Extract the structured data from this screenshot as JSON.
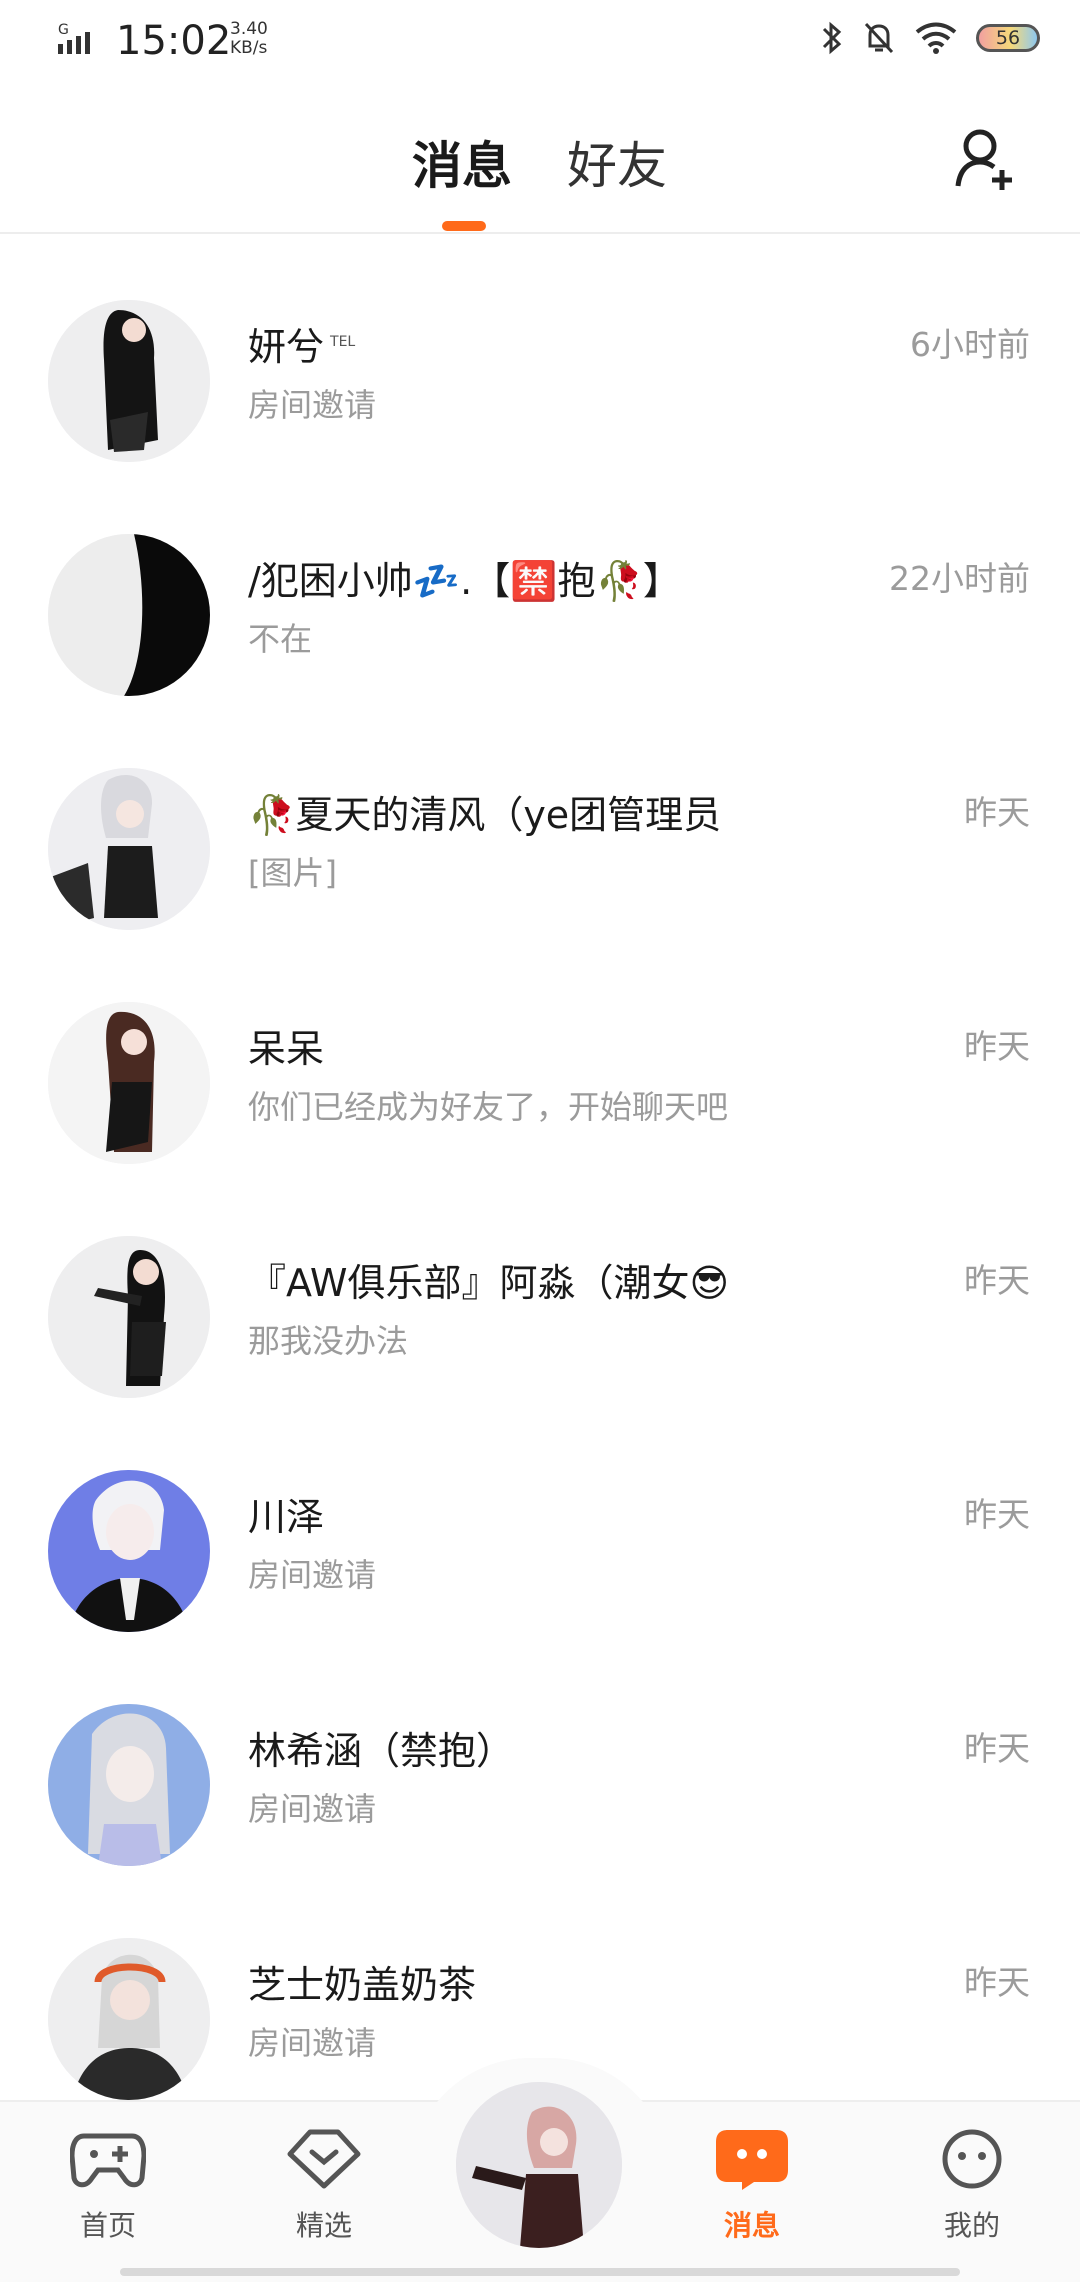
{
  "status_bar": {
    "network": "G",
    "time": "15:02",
    "speed_value": "3.40",
    "speed_unit": "KB/s",
    "battery": "56"
  },
  "header": {
    "tab_messages": "消息",
    "tab_friends": "好友"
  },
  "conversations": [
    {
      "name": "妍兮",
      "badge": "TEL",
      "preview": "房间邀请",
      "time": "6小时前"
    },
    {
      "name": "/犯困小帅💤.【🈲抱🥀】",
      "preview": "不在",
      "time": "22小时前"
    },
    {
      "name": "🥀夏天的清风（ye团管理员",
      "preview": "[图片]",
      "time": "昨天"
    },
    {
      "name": "呆呆",
      "preview": "你们已经成为好友了，开始聊天吧",
      "time": "昨天"
    },
    {
      "name": "『AW俱乐部』阿淼（潮女😎",
      "preview": "那我没办法",
      "time": "昨天"
    },
    {
      "name": "川泽",
      "preview": "房间邀请",
      "time": "昨天"
    },
    {
      "name": "林希涵（禁抱）",
      "preview": "房间邀请",
      "time": "昨天"
    },
    {
      "name": "芝士奶盖奶茶",
      "preview": "房间邀请",
      "time": "昨天"
    }
  ],
  "bottom_nav": {
    "home": "首页",
    "featured": "精选",
    "messages": "消息",
    "mine": "我的"
  },
  "colors": {
    "accent": "#ff6a1a",
    "muted_text": "#9b9b9b"
  }
}
